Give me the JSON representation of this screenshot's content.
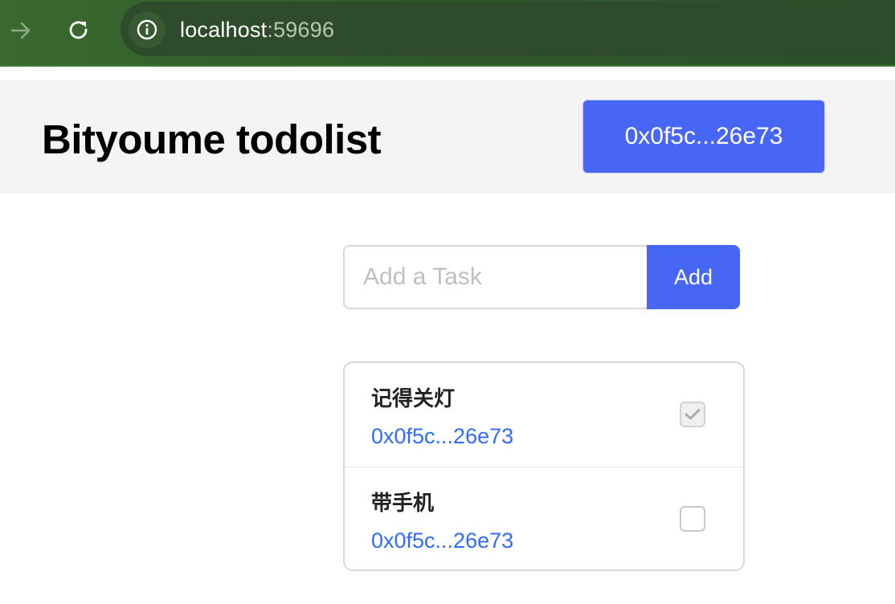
{
  "browser": {
    "url_host": "localhost",
    "url_port": ":59696"
  },
  "header": {
    "title": "Bityoume todolist",
    "wallet_label": "0x0f5c...26e73"
  },
  "add_task": {
    "placeholder": "Add a Task",
    "button_label": "Add"
  },
  "tasks": [
    {
      "title": "记得关灯",
      "owner": "0x0f5c...26e73",
      "completed": true
    },
    {
      "title": "带手机",
      "owner": "0x0f5c...26e73",
      "completed": false
    }
  ],
  "colors": {
    "accent": "#4766f5",
    "link": "#2f6bff",
    "browser_bar": "#2e4b2b"
  }
}
